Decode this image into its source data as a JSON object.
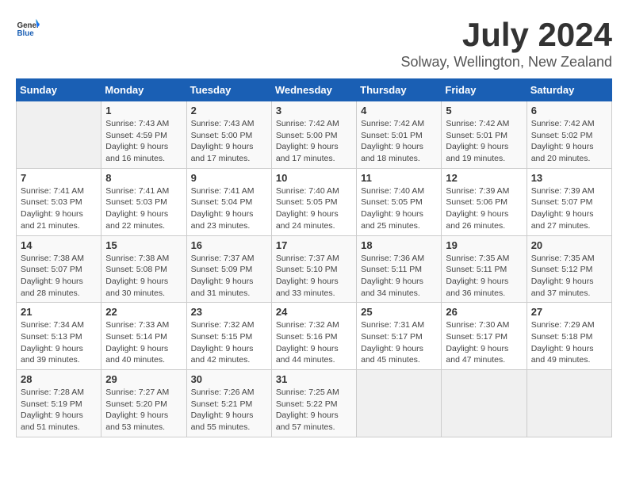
{
  "header": {
    "logo_general": "General",
    "logo_blue": "Blue",
    "month": "July 2024",
    "location": "Solway, Wellington, New Zealand"
  },
  "weekdays": [
    "Sunday",
    "Monday",
    "Tuesday",
    "Wednesday",
    "Thursday",
    "Friday",
    "Saturday"
  ],
  "weeks": [
    [
      {
        "day": "",
        "info": ""
      },
      {
        "day": "1",
        "info": "Sunrise: 7:43 AM\nSunset: 4:59 PM\nDaylight: 9 hours\nand 16 minutes."
      },
      {
        "day": "2",
        "info": "Sunrise: 7:43 AM\nSunset: 5:00 PM\nDaylight: 9 hours\nand 17 minutes."
      },
      {
        "day": "3",
        "info": "Sunrise: 7:42 AM\nSunset: 5:00 PM\nDaylight: 9 hours\nand 17 minutes."
      },
      {
        "day": "4",
        "info": "Sunrise: 7:42 AM\nSunset: 5:01 PM\nDaylight: 9 hours\nand 18 minutes."
      },
      {
        "day": "5",
        "info": "Sunrise: 7:42 AM\nSunset: 5:01 PM\nDaylight: 9 hours\nand 19 minutes."
      },
      {
        "day": "6",
        "info": "Sunrise: 7:42 AM\nSunset: 5:02 PM\nDaylight: 9 hours\nand 20 minutes."
      }
    ],
    [
      {
        "day": "7",
        "info": "Sunrise: 7:41 AM\nSunset: 5:03 PM\nDaylight: 9 hours\nand 21 minutes."
      },
      {
        "day": "8",
        "info": "Sunrise: 7:41 AM\nSunset: 5:03 PM\nDaylight: 9 hours\nand 22 minutes."
      },
      {
        "day": "9",
        "info": "Sunrise: 7:41 AM\nSunset: 5:04 PM\nDaylight: 9 hours\nand 23 minutes."
      },
      {
        "day": "10",
        "info": "Sunrise: 7:40 AM\nSunset: 5:05 PM\nDaylight: 9 hours\nand 24 minutes."
      },
      {
        "day": "11",
        "info": "Sunrise: 7:40 AM\nSunset: 5:05 PM\nDaylight: 9 hours\nand 25 minutes."
      },
      {
        "day": "12",
        "info": "Sunrise: 7:39 AM\nSunset: 5:06 PM\nDaylight: 9 hours\nand 26 minutes."
      },
      {
        "day": "13",
        "info": "Sunrise: 7:39 AM\nSunset: 5:07 PM\nDaylight: 9 hours\nand 27 minutes."
      }
    ],
    [
      {
        "day": "14",
        "info": "Sunrise: 7:38 AM\nSunset: 5:07 PM\nDaylight: 9 hours\nand 28 minutes."
      },
      {
        "day": "15",
        "info": "Sunrise: 7:38 AM\nSunset: 5:08 PM\nDaylight: 9 hours\nand 30 minutes."
      },
      {
        "day": "16",
        "info": "Sunrise: 7:37 AM\nSunset: 5:09 PM\nDaylight: 9 hours\nand 31 minutes."
      },
      {
        "day": "17",
        "info": "Sunrise: 7:37 AM\nSunset: 5:10 PM\nDaylight: 9 hours\nand 33 minutes."
      },
      {
        "day": "18",
        "info": "Sunrise: 7:36 AM\nSunset: 5:11 PM\nDaylight: 9 hours\nand 34 minutes."
      },
      {
        "day": "19",
        "info": "Sunrise: 7:35 AM\nSunset: 5:11 PM\nDaylight: 9 hours\nand 36 minutes."
      },
      {
        "day": "20",
        "info": "Sunrise: 7:35 AM\nSunset: 5:12 PM\nDaylight: 9 hours\nand 37 minutes."
      }
    ],
    [
      {
        "day": "21",
        "info": "Sunrise: 7:34 AM\nSunset: 5:13 PM\nDaylight: 9 hours\nand 39 minutes."
      },
      {
        "day": "22",
        "info": "Sunrise: 7:33 AM\nSunset: 5:14 PM\nDaylight: 9 hours\nand 40 minutes."
      },
      {
        "day": "23",
        "info": "Sunrise: 7:32 AM\nSunset: 5:15 PM\nDaylight: 9 hours\nand 42 minutes."
      },
      {
        "day": "24",
        "info": "Sunrise: 7:32 AM\nSunset: 5:16 PM\nDaylight: 9 hours\nand 44 minutes."
      },
      {
        "day": "25",
        "info": "Sunrise: 7:31 AM\nSunset: 5:17 PM\nDaylight: 9 hours\nand 45 minutes."
      },
      {
        "day": "26",
        "info": "Sunrise: 7:30 AM\nSunset: 5:17 PM\nDaylight: 9 hours\nand 47 minutes."
      },
      {
        "day": "27",
        "info": "Sunrise: 7:29 AM\nSunset: 5:18 PM\nDaylight: 9 hours\nand 49 minutes."
      }
    ],
    [
      {
        "day": "28",
        "info": "Sunrise: 7:28 AM\nSunset: 5:19 PM\nDaylight: 9 hours\nand 51 minutes."
      },
      {
        "day": "29",
        "info": "Sunrise: 7:27 AM\nSunset: 5:20 PM\nDaylight: 9 hours\nand 53 minutes."
      },
      {
        "day": "30",
        "info": "Sunrise: 7:26 AM\nSunset: 5:21 PM\nDaylight: 9 hours\nand 55 minutes."
      },
      {
        "day": "31",
        "info": "Sunrise: 7:25 AM\nSunset: 5:22 PM\nDaylight: 9 hours\nand 57 minutes."
      },
      {
        "day": "",
        "info": ""
      },
      {
        "day": "",
        "info": ""
      },
      {
        "day": "",
        "info": ""
      }
    ]
  ]
}
